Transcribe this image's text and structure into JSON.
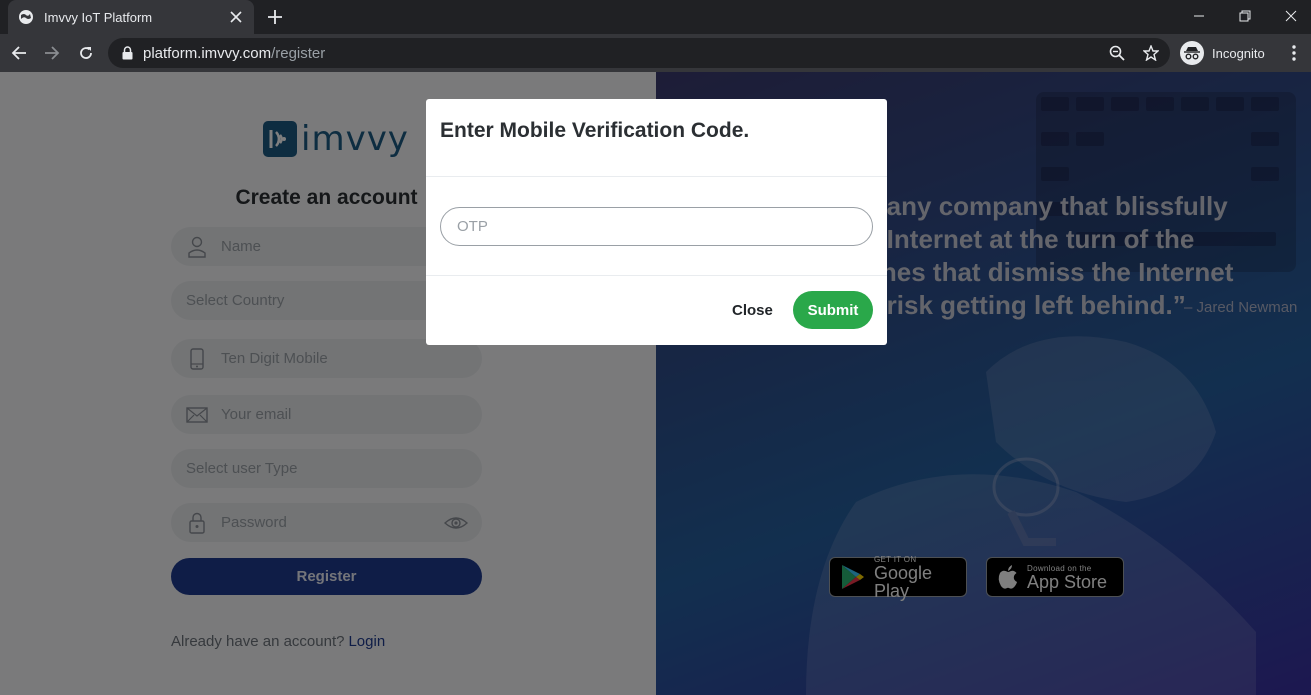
{
  "browser": {
    "tab_title": "Imvvy IoT Platform",
    "url_host": "platform.imvvy.com",
    "url_path": "/register",
    "incognito_label": "Incognito"
  },
  "brand": {
    "logo_text": "imvvy",
    "color": "#1d5a82"
  },
  "form": {
    "title": "Create an account",
    "name_placeholder": "Name",
    "country_placeholder": "Select Country",
    "mobile_placeholder": "Ten Digit Mobile",
    "email_placeholder": "Your email",
    "user_type_placeholder": "Select user Type",
    "password_placeholder": "Password",
    "register_label": "Register",
    "login_prompt": "Already have an account?",
    "login_link": "Login",
    "accent_color": "#1e3a8f"
  },
  "quote": {
    "lines": [
      "e any company that blissfully",
      "e Internet at the turn of the",
      "ones that dismiss the Internet",
      "s risk getting left behind.”"
    ],
    "author": "– Jared Newman"
  },
  "stores": {
    "google_small": "GET IT ON",
    "google_big": "Google Play",
    "apple_small": "Download on the",
    "apple_big": "App Store"
  },
  "modal": {
    "title": "Enter Mobile Verification Code.",
    "otp_placeholder": "OTP",
    "close_label": "Close",
    "submit_label": "Submit",
    "submit_color": "#2aa84a"
  }
}
